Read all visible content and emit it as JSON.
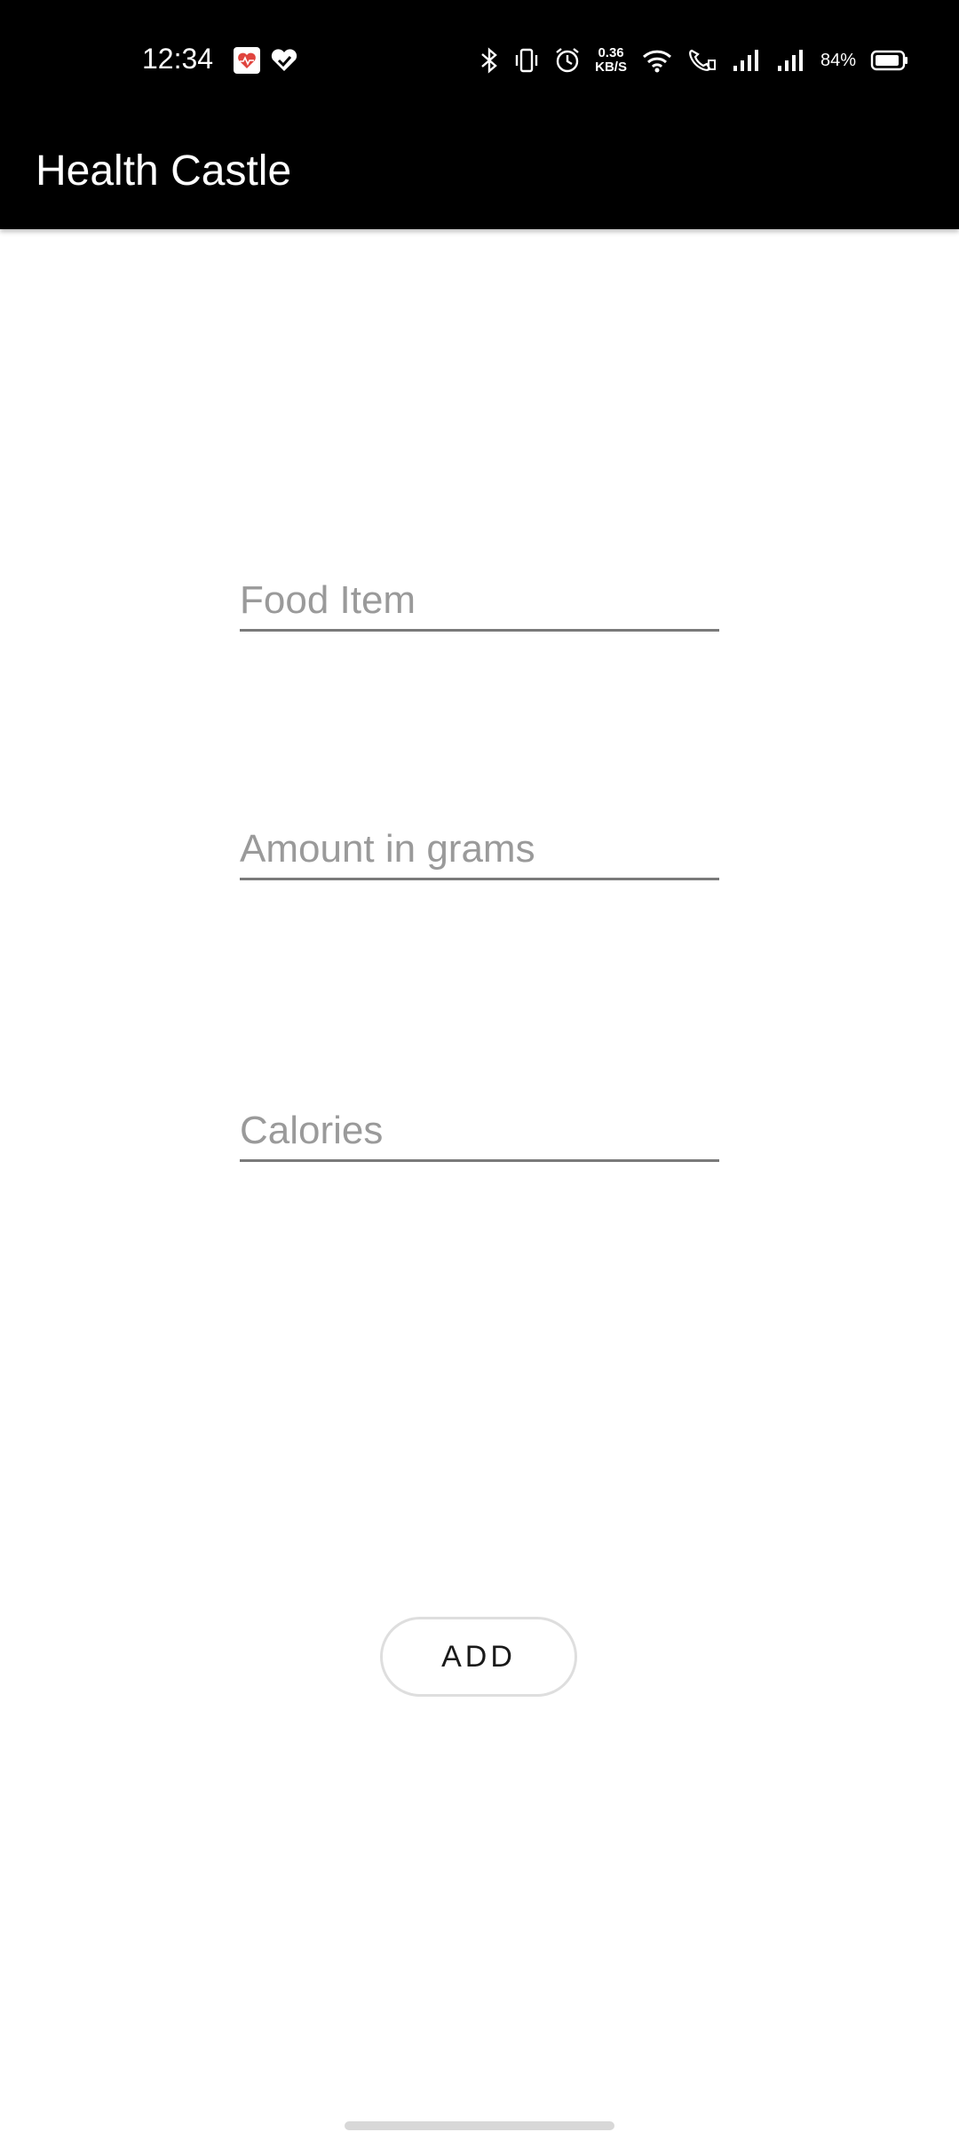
{
  "status_bar": {
    "time": "12:34",
    "net_speed_value": "0.36",
    "net_speed_unit": "KB/S",
    "battery_percent": "84%",
    "icons": [
      "health-app-icon",
      "heart-check-icon",
      "bluetooth-icon",
      "vibrate-icon",
      "alarm-icon",
      "wifi-icon",
      "wifi-calling-icon",
      "signal-icon",
      "signal-icon",
      "battery-icon"
    ]
  },
  "app_bar": {
    "title": "Health Castle"
  },
  "form": {
    "food_item_placeholder": "Food Item",
    "amount_placeholder": "Amount in grams",
    "calories_placeholder": "Calories",
    "add_label": "ADD"
  },
  "colors": {
    "bar_background": "#000000",
    "underline": "#7a7a7a",
    "hint_text": "#9a9a9a"
  }
}
